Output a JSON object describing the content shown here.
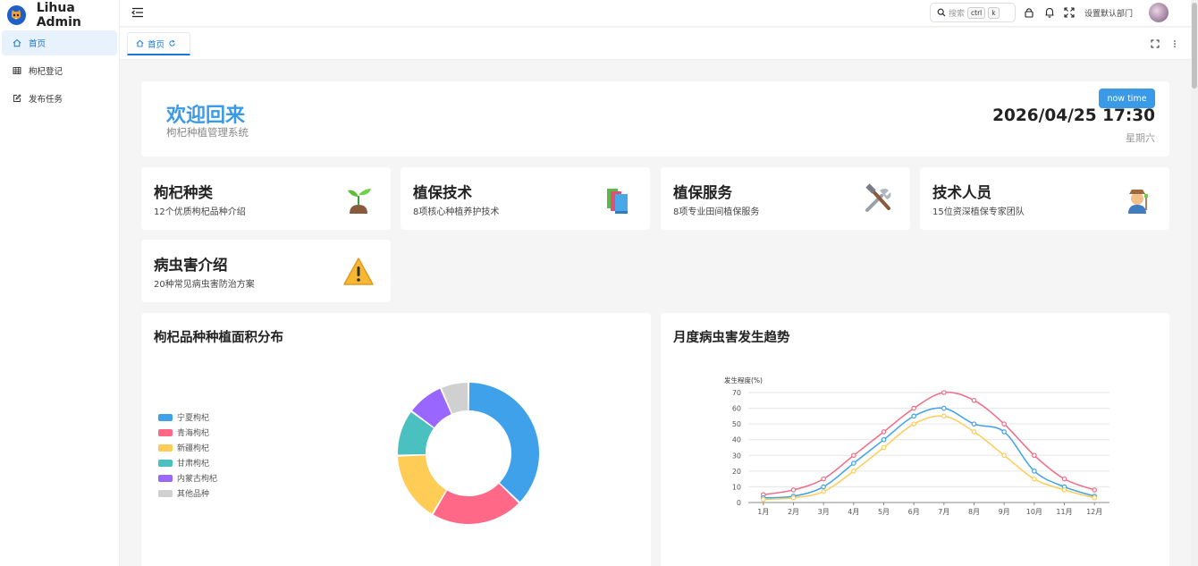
{
  "app": {
    "title": "Lihua Admin"
  },
  "sidebar": {
    "items": [
      {
        "label": "首页",
        "icon": "home-icon",
        "active": true
      },
      {
        "label": "枸杞登记",
        "icon": "table-icon",
        "active": false
      },
      {
        "label": "发布任务",
        "icon": "edit-icon",
        "active": false
      }
    ]
  },
  "header": {
    "search": {
      "placeholder": "搜索",
      "key1": "ctrl",
      "key2": "k"
    },
    "dept_label": "设置默认部门"
  },
  "tabs": [
    {
      "label": "首页"
    }
  ],
  "welcome": {
    "title": "欢迎回来",
    "subtitle": "枸杞种植管理系统",
    "now_button": "now time",
    "datetime": "2026/04/25 17:30",
    "weekday": "星期六"
  },
  "features": [
    {
      "title": "枸杞种类",
      "desc": "12个优质枸杞品种介绍",
      "icon": "seedling-icon"
    },
    {
      "title": "植保技术",
      "desc": "8项核心种植养护技术",
      "icon": "books-icon"
    },
    {
      "title": "植保服务",
      "desc": "8项专业田间植保服务",
      "icon": "tools-icon"
    },
    {
      "title": "技术人员",
      "desc": "15位资深植保专家团队",
      "icon": "farmer-icon"
    },
    {
      "title": "病虫害介绍",
      "desc": "20种常见病虫害防治方案",
      "icon": "warning-icon"
    }
  ],
  "colors": {
    "accent": "#3b9ae8",
    "active_bg": "#e8f2fd"
  },
  "panels": {
    "pie_title": "枸杞品种种植面积分布",
    "line_title": "月度病虫害发生趋势"
  },
  "chart_data": [
    {
      "type": "pie",
      "donut": true,
      "legend": "left",
      "labels": [
        "宁夏枸杞",
        "青海枸杞",
        "新疆枸杞",
        "甘肃枸杞",
        "内蒙古枸杞",
        "其他品种"
      ],
      "values": [
        35,
        20,
        15,
        10,
        8,
        6
      ],
      "colors": [
        "#3ea1ea",
        "#ff6886",
        "#ffcc55",
        "#4bc0c0",
        "#9966ff",
        "#d0d0d0"
      ]
    },
    {
      "type": "line",
      "ylabel": "发生程度(%)",
      "ylim": [
        0,
        70
      ],
      "yticks": [
        0,
        10,
        20,
        30,
        40,
        50,
        60,
        70
      ],
      "grid": true,
      "categories": [
        "1月",
        "2月",
        "3月",
        "4月",
        "5月",
        "6月",
        "7月",
        "8月",
        "9月",
        "10月",
        "11月",
        "12月"
      ],
      "series": [
        {
          "values": [
            5,
            8,
            15,
            30,
            45,
            60,
            70,
            65,
            50,
            30,
            15,
            8
          ],
          "color": "#ef6b86"
        },
        {
          "values": [
            3,
            4,
            10,
            25,
            40,
            55,
            60,
            50,
            45,
            20,
            10,
            4
          ],
          "color": "#3ea1ea"
        },
        {
          "values": [
            2,
            3,
            7,
            20,
            35,
            50,
            55,
            45,
            30,
            15,
            8,
            3
          ],
          "color": "#ffcc55"
        }
      ]
    }
  ]
}
